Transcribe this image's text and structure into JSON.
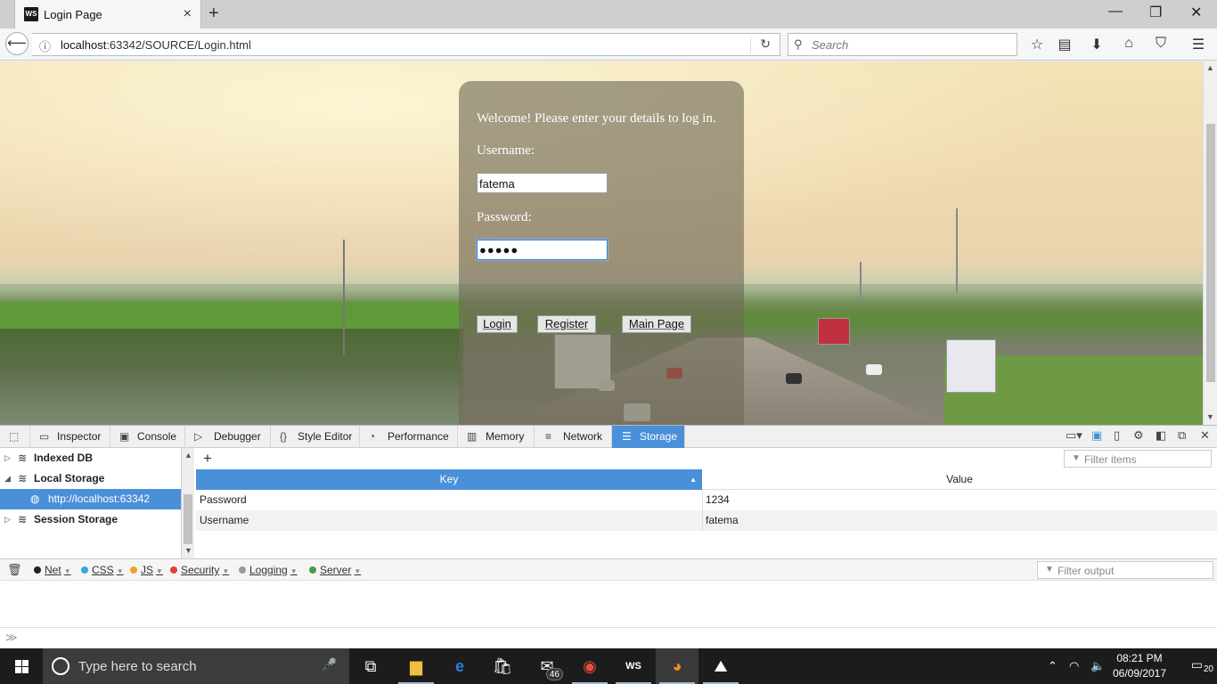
{
  "browser": {
    "tab_title": "Login Page",
    "tab_favicon": "WS",
    "tab_close": "×",
    "new_tab": "+",
    "window": {
      "minimize": "—",
      "restore": "❐",
      "close": "✕"
    },
    "url_host": "localhost",
    "url_rest": ":63342/SOURCE/Login.html",
    "search_placeholder": "Search"
  },
  "page": {
    "welcome": "Welcome! Please enter your details to log in.",
    "username_label": "Username:",
    "username_value": "fatema",
    "password_label": "Password:",
    "password_value": "●●●●●",
    "login_button": "Login",
    "register_button": "Register",
    "main_page_button": "Main Page"
  },
  "devtools": {
    "tabs": [
      "Inspector",
      "Console",
      "Debugger",
      "Style Editor",
      "Performance",
      "Memory",
      "Network",
      "Storage"
    ],
    "active_tab": "Storage",
    "tree": {
      "indexed_db": "Indexed DB",
      "local_storage": "Local Storage",
      "local_origin": "http://localhost:63342",
      "session_storage": "Session Storage"
    },
    "add_item": "+",
    "filter_items_placeholder": "Filter items",
    "table": {
      "columns": [
        "Key",
        "Value"
      ],
      "rows": [
        {
          "key": "Password",
          "value": "1234"
        },
        {
          "key": "Username",
          "value": "fatema"
        }
      ]
    },
    "console_filters": [
      {
        "label": "Net",
        "color": "#222222"
      },
      {
        "label": "CSS",
        "color": "#3aa6e0"
      },
      {
        "label": "JS",
        "color": "#f0a020"
      },
      {
        "label": "Security",
        "color": "#e04040"
      },
      {
        "label": "Logging",
        "color": "#999999"
      },
      {
        "label": "Server",
        "color": "#4a9a4a"
      }
    ],
    "filter_output_placeholder": "Filter output"
  },
  "taskbar": {
    "search_placeholder": "Type here to search",
    "mail_badge": "46",
    "time": "08:21 PM",
    "date": "06/09/2017",
    "notification_count": "20"
  },
  "colors": {
    "accent": "#4a90d9",
    "taskbar": "#1c1c1c"
  }
}
